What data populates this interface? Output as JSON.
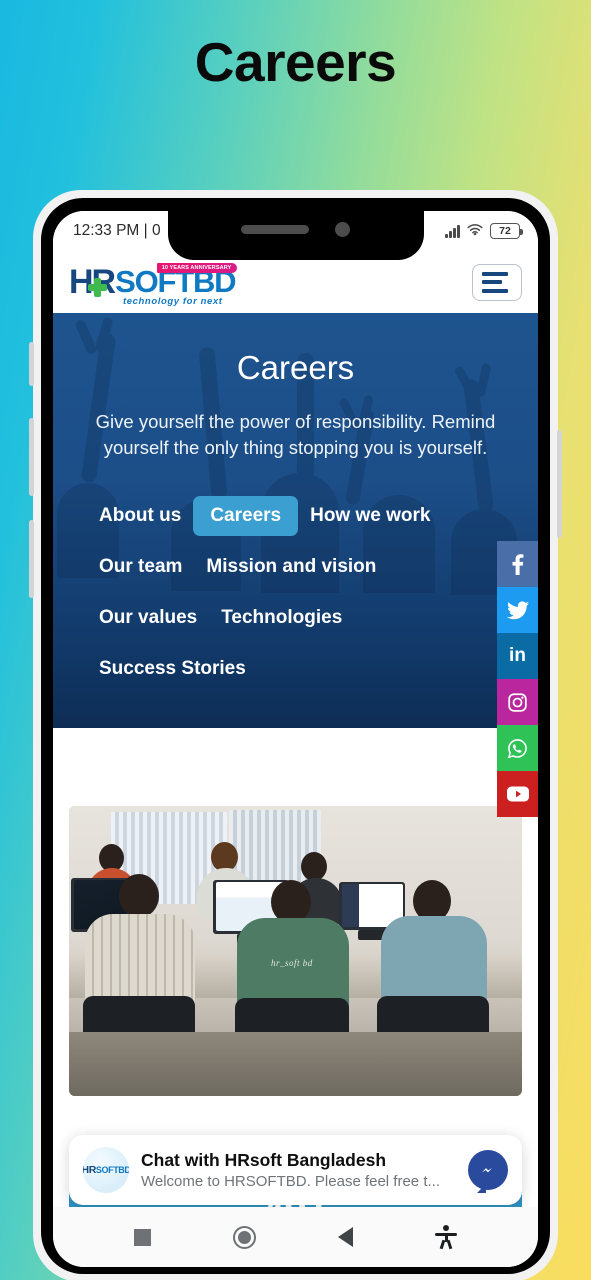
{
  "page": {
    "title": "Careers"
  },
  "phone": {
    "statusbar": {
      "time": "12:33 PM | 0",
      "battery": "72",
      "signal_icon": "signal-bars-icon",
      "wifi_icon": "wifi-icon",
      "battery_icon": "battery-icon"
    },
    "navbar": {
      "recents_label": "recents-icon",
      "home_label": "home-icon",
      "back_label": "back-icon",
      "accessibility_label": "accessibility-icon"
    }
  },
  "site_header": {
    "logo": {
      "hr": "HR",
      "softbd": "SOFTBD",
      "tagline": "technology for next",
      "anniversary": "10 YEARS ANNIVERSARY"
    },
    "menu_button_label": "menu-icon"
  },
  "hero": {
    "title": "Careers",
    "subtitle": "Give yourself the power of responsibility. Remind yourself the only thing stopping you is yourself.",
    "nav_rows": [
      [
        {
          "label": "About us",
          "active": false
        },
        {
          "label": "Careers",
          "active": true
        },
        {
          "label": "How we work",
          "active": false
        }
      ],
      [
        {
          "label": "Our team",
          "active": false
        },
        {
          "label": "Mission and vision",
          "active": false
        }
      ],
      [
        {
          "label": "Our values",
          "active": false
        },
        {
          "label": "Technologies",
          "active": false
        }
      ],
      [
        {
          "label": "Success Stories",
          "active": false
        }
      ]
    ]
  },
  "social_rail": [
    {
      "name": "facebook",
      "glyph": "f",
      "color": "#4a6ea8"
    },
    {
      "name": "twitter",
      "glyph": "t",
      "color": "#1d9bf0"
    },
    {
      "name": "linkedin",
      "glyph": "in",
      "color": "#0b6ca5"
    },
    {
      "name": "instagram",
      "glyph": "ig",
      "color": "#b9269e"
    },
    {
      "name": "whatsapp",
      "glyph": "wa",
      "color": "#2fc257"
    },
    {
      "name": "youtube",
      "glyph": "yt",
      "color": "#cc1f1f"
    }
  ],
  "photo": {
    "alt": "office-team-photo",
    "shirt_text": "hr_soft bd"
  },
  "chat_widget": {
    "avatar_hr": "HR",
    "avatar_soft": "SOFTBD",
    "title": "Chat with HRsoft Bangladesh",
    "subtitle": "Welcome to HRSOFTBD. Please feel free t...",
    "messenger_icon": "messenger-icon"
  },
  "counter": {
    "value": "491"
  },
  "colors": {
    "accent_blue": "#3b9fd1",
    "hero_dark": "#123a6b",
    "logo_navy": "#16477e",
    "logo_blue": "#1079c4",
    "logo_green": "#3fba4f",
    "anniversary_pink": "#e8166f",
    "counter_blue": "#2f93c4"
  }
}
